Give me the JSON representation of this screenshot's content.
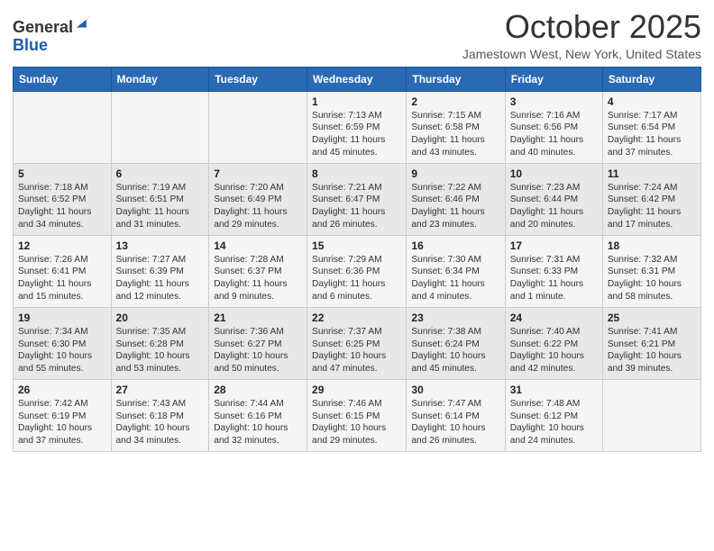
{
  "logo": {
    "general": "General",
    "blue": "Blue"
  },
  "header": {
    "month": "October 2025",
    "location": "Jamestown West, New York, United States"
  },
  "days_of_week": [
    "Sunday",
    "Monday",
    "Tuesday",
    "Wednesday",
    "Thursday",
    "Friday",
    "Saturday"
  ],
  "weeks": [
    [
      {
        "day": "",
        "info": ""
      },
      {
        "day": "",
        "info": ""
      },
      {
        "day": "",
        "info": ""
      },
      {
        "day": "1",
        "info": "Sunrise: 7:13 AM\nSunset: 6:59 PM\nDaylight: 11 hours and 45 minutes."
      },
      {
        "day": "2",
        "info": "Sunrise: 7:15 AM\nSunset: 6:58 PM\nDaylight: 11 hours and 43 minutes."
      },
      {
        "day": "3",
        "info": "Sunrise: 7:16 AM\nSunset: 6:56 PM\nDaylight: 11 hours and 40 minutes."
      },
      {
        "day": "4",
        "info": "Sunrise: 7:17 AM\nSunset: 6:54 PM\nDaylight: 11 hours and 37 minutes."
      }
    ],
    [
      {
        "day": "5",
        "info": "Sunrise: 7:18 AM\nSunset: 6:52 PM\nDaylight: 11 hours and 34 minutes."
      },
      {
        "day": "6",
        "info": "Sunrise: 7:19 AM\nSunset: 6:51 PM\nDaylight: 11 hours and 31 minutes."
      },
      {
        "day": "7",
        "info": "Sunrise: 7:20 AM\nSunset: 6:49 PM\nDaylight: 11 hours and 29 minutes."
      },
      {
        "day": "8",
        "info": "Sunrise: 7:21 AM\nSunset: 6:47 PM\nDaylight: 11 hours and 26 minutes."
      },
      {
        "day": "9",
        "info": "Sunrise: 7:22 AM\nSunset: 6:46 PM\nDaylight: 11 hours and 23 minutes."
      },
      {
        "day": "10",
        "info": "Sunrise: 7:23 AM\nSunset: 6:44 PM\nDaylight: 11 hours and 20 minutes."
      },
      {
        "day": "11",
        "info": "Sunrise: 7:24 AM\nSunset: 6:42 PM\nDaylight: 11 hours and 17 minutes."
      }
    ],
    [
      {
        "day": "12",
        "info": "Sunrise: 7:26 AM\nSunset: 6:41 PM\nDaylight: 11 hours and 15 minutes."
      },
      {
        "day": "13",
        "info": "Sunrise: 7:27 AM\nSunset: 6:39 PM\nDaylight: 11 hours and 12 minutes."
      },
      {
        "day": "14",
        "info": "Sunrise: 7:28 AM\nSunset: 6:37 PM\nDaylight: 11 hours and 9 minutes."
      },
      {
        "day": "15",
        "info": "Sunrise: 7:29 AM\nSunset: 6:36 PM\nDaylight: 11 hours and 6 minutes."
      },
      {
        "day": "16",
        "info": "Sunrise: 7:30 AM\nSunset: 6:34 PM\nDaylight: 11 hours and 4 minutes."
      },
      {
        "day": "17",
        "info": "Sunrise: 7:31 AM\nSunset: 6:33 PM\nDaylight: 11 hours and 1 minute."
      },
      {
        "day": "18",
        "info": "Sunrise: 7:32 AM\nSunset: 6:31 PM\nDaylight: 10 hours and 58 minutes."
      }
    ],
    [
      {
        "day": "19",
        "info": "Sunrise: 7:34 AM\nSunset: 6:30 PM\nDaylight: 10 hours and 55 minutes."
      },
      {
        "day": "20",
        "info": "Sunrise: 7:35 AM\nSunset: 6:28 PM\nDaylight: 10 hours and 53 minutes."
      },
      {
        "day": "21",
        "info": "Sunrise: 7:36 AM\nSunset: 6:27 PM\nDaylight: 10 hours and 50 minutes."
      },
      {
        "day": "22",
        "info": "Sunrise: 7:37 AM\nSunset: 6:25 PM\nDaylight: 10 hours and 47 minutes."
      },
      {
        "day": "23",
        "info": "Sunrise: 7:38 AM\nSunset: 6:24 PM\nDaylight: 10 hours and 45 minutes."
      },
      {
        "day": "24",
        "info": "Sunrise: 7:40 AM\nSunset: 6:22 PM\nDaylight: 10 hours and 42 minutes."
      },
      {
        "day": "25",
        "info": "Sunrise: 7:41 AM\nSunset: 6:21 PM\nDaylight: 10 hours and 39 minutes."
      }
    ],
    [
      {
        "day": "26",
        "info": "Sunrise: 7:42 AM\nSunset: 6:19 PM\nDaylight: 10 hours and 37 minutes."
      },
      {
        "day": "27",
        "info": "Sunrise: 7:43 AM\nSunset: 6:18 PM\nDaylight: 10 hours and 34 minutes."
      },
      {
        "day": "28",
        "info": "Sunrise: 7:44 AM\nSunset: 6:16 PM\nDaylight: 10 hours and 32 minutes."
      },
      {
        "day": "29",
        "info": "Sunrise: 7:46 AM\nSunset: 6:15 PM\nDaylight: 10 hours and 29 minutes."
      },
      {
        "day": "30",
        "info": "Sunrise: 7:47 AM\nSunset: 6:14 PM\nDaylight: 10 hours and 26 minutes."
      },
      {
        "day": "31",
        "info": "Sunrise: 7:48 AM\nSunset: 6:12 PM\nDaylight: 10 hours and 24 minutes."
      },
      {
        "day": "",
        "info": ""
      }
    ]
  ]
}
